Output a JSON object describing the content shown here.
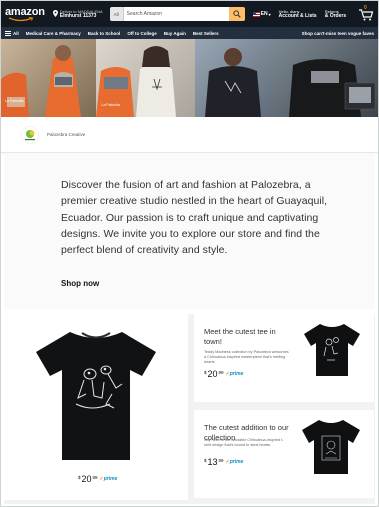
{
  "nav": {
    "logo": "amazon",
    "deliver_line1": "Deliver to MADDALENA",
    "deliver_line2": "Elmhurst 11373",
    "search_category": "All",
    "search_placeholder": "Search Amazon",
    "language": "EN",
    "account_line1": "Hello, diany",
    "account_line2": "Account & Lists",
    "returns_line1": "Returns",
    "returns_line2": "& Orders",
    "cart_count": "0"
  },
  "subnav": {
    "all": "All",
    "items": [
      "Medical Care & Pharmacy",
      "Back to School",
      "Off to College",
      "Buy Again",
      "Best Sellers"
    ],
    "promo": "Shop can't-miss teen vogue faves"
  },
  "hero": {
    "caption1": "La Palomita",
    "caption2": "La Palomita"
  },
  "brand": {
    "name": "Palozebra Creative"
  },
  "intro": {
    "text": "Discover the fusion of art and fashion at Palozebra, a premier creative studio nestled in the heart of Guayaquil, Ecuador. Our passion is to craft unique and captivating designs. We invite you to explore our store and find the perfect blend of creativity and style.",
    "cta": "Shop now"
  },
  "products": {
    "big": {
      "price_symbol": "$",
      "price_whole": "20",
      "price_cents": "99",
      "prime": "prime"
    },
    "card1": {
      "title": "Meet the cutest tee in town!",
      "description": "Teddy Madness collection by Palozebra welcomes a Chihuahua-inspired masterpiece that's melting hearts",
      "price_symbol": "$",
      "price_whole": "20",
      "price_cents": "99",
      "prime": "prime"
    },
    "card2": {
      "title": "The cutest addition to our collection",
      "description": "Say hello to our adorable Chihuahua-inspired t-shirt design that's bound to steal hearts.",
      "price_symbol": "$",
      "price_whole": "13",
      "price_cents": "99",
      "prime": "prime"
    }
  },
  "colors": {
    "nav_bg": "#131921",
    "subnav_bg": "#232f3e",
    "search_button": "#febd69",
    "accent": "#f08804",
    "prime_blue": "#0f8dbb"
  }
}
